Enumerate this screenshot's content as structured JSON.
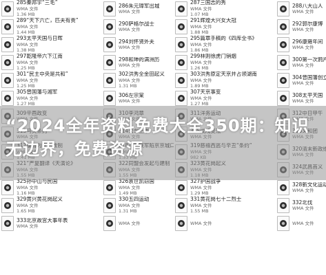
{
  "headline": "“2024全年资料免费大全350期：知识无边界，免费资源",
  "file_type": "WMA 文件",
  "files": [
    {
      "name": "285秦邦宇“三毛”",
      "size": "1.36 MB"
    },
    {
      "name": "286朱元璋军出城",
      "size": ""
    },
    {
      "name": "287三国志的秀",
      "size": "1.07 MB"
    },
    {
      "name": "288八大山人",
      "size": ""
    },
    {
      "name": "289“天下六亡，匹夫有责”",
      "size": "1.44 MB"
    },
    {
      "name": "290萨格尔战士",
      "size": ""
    },
    {
      "name": "291辉煌大兴女大冠",
      "size": "1.88 MB"
    },
    {
      "name": "292郭尔康博",
      "size": ""
    },
    {
      "name": "293太平天国与日晖",
      "size": "1.38 MB"
    },
    {
      "name": "294刘怀贤外夫",
      "size": ""
    },
    {
      "name": "295篇章手稿的《四库全书》",
      "size": "1.86 MB"
    },
    {
      "name": "296康雍年间",
      "size": ""
    },
    {
      "name": "297乾隆帝六下江南",
      "size": "1.25 MB"
    },
    {
      "name": "298和珅的满洲历",
      "size": ""
    },
    {
      "name": "299林则徐虎门销烟",
      "size": "1.26 MB"
    },
    {
      "name": "300第一次鸦片战争",
      "size": ""
    },
    {
      "name": "301“民主中央是共和”",
      "size": "1.25 MB"
    },
    {
      "name": "302洪秀全金田起义",
      "size": "1.31 MB"
    },
    {
      "name": "303洪秀原定天京并占领湖南",
      "size": "1.89 MB"
    },
    {
      "name": "304曾国藩创立太平军",
      "size": ""
    },
    {
      "name": "305曾国藩与湘军",
      "size": "1.27 MB"
    },
    {
      "name": "306左宗棠",
      "size": ""
    },
    {
      "name": "307天京事变",
      "size": "1.27 MB"
    },
    {
      "name": "308太平天国",
      "size": ""
    },
    {
      "name": "309辛酉政变",
      "size": ""
    },
    {
      "name": "310李鸿章",
      "size": ""
    },
    {
      "name": "311洋务运动",
      "size": ""
    },
    {
      "name": "312中日甲午",
      "size": ""
    },
    {
      "name": "313马关条约",
      "size": ""
    },
    {
      "name": "314公车上书",
      "size": ""
    },
    {
      "name": "315戊戌变法",
      "size": ""
    },
    {
      "name": "316义和团",
      "size": ""
    },
    {
      "name": "317康有为变法改制",
      "size": "1.41 MB"
    },
    {
      "name": "318八国联军陷京京城口",
      "size": "1.53 MB"
    },
    {
      "name": "319慈禧西逃与辛丑“条约”",
      "size": "982 KB"
    },
    {
      "name": "320清末新政维新中之",
      "size": ""
    },
    {
      "name": "321“严复翻译《天演论》",
      "size": "1.55 MB"
    },
    {
      "name": "322同盟会发起与建制",
      "size": "1.55 MB"
    },
    {
      "name": "323黄花岗起义",
      "size": "1.18 MB"
    },
    {
      "name": "324武昌首义",
      "size": ""
    },
    {
      "name": "325孙中山与民国",
      "size": "1.16 MB"
    },
    {
      "name": "326袁世凯窃国",
      "size": "1.49 MB"
    },
    {
      "name": "327护国战争",
      "size": "1.29 MB"
    },
    {
      "name": "328新文化运动",
      "size": ""
    },
    {
      "name": "329黄兴黄花岗起义",
      "size": "1.65 MB"
    },
    {
      "name": "330五四运动",
      "size": "1.31 MB"
    },
    {
      "name": "331黄花岗七十二烈士",
      "size": "1.55 MB"
    },
    {
      "name": "332北伐",
      "size": ""
    },
    {
      "name": "333北京故宫大事年表",
      "size": ""
    },
    {
      "name": "",
      "size": ""
    },
    {
      "name": "",
      "size": ""
    },
    {
      "name": "",
      "size": ""
    }
  ]
}
